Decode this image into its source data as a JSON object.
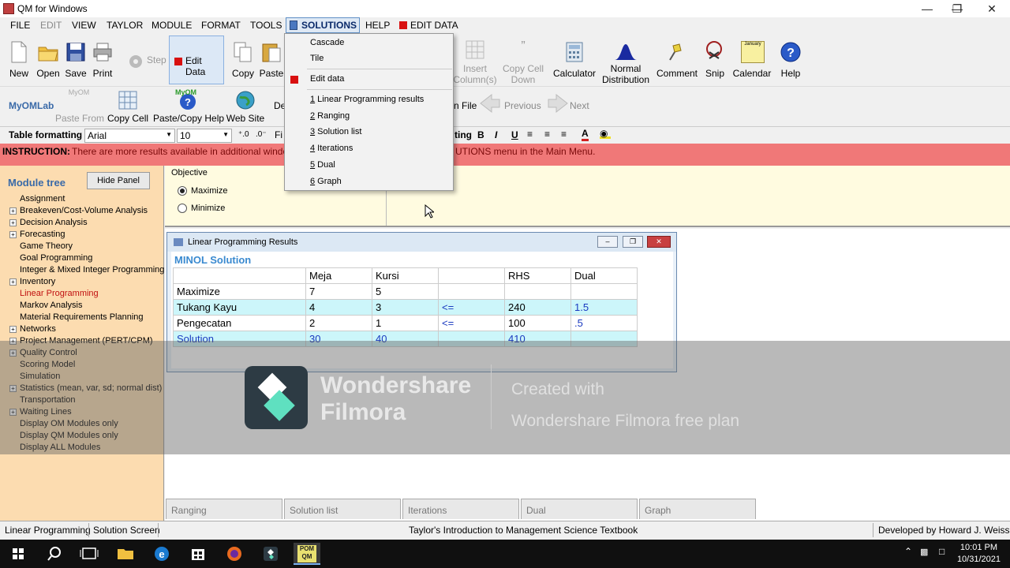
{
  "window": {
    "title": "QM for Windows"
  },
  "menu": {
    "file": "FILE",
    "edit": "EDIT",
    "view": "VIEW",
    "taylor": "TAYLOR",
    "module": "MODULE",
    "format": "FORMAT",
    "tools": "TOOLS",
    "solutions": "SOLUTIONS",
    "help": "HELP",
    "edit_data": "EDIT DATA"
  },
  "toolbar": {
    "new": "New",
    "open": "Open",
    "save": "Save",
    "print": "Print",
    "step": "Step",
    "edit_data": "Edit Data",
    "copy": "Copy",
    "paste": "Paste",
    "insert_columns_1": "Insert",
    "insert_columns_2": "Column(s)",
    "copy_cell_down_1": "Copy Cell",
    "copy_cell_down_2": "Down",
    "calculator": "Calculator",
    "normal_dist_1": "Normal",
    "normal_dist_2": "Distribution",
    "comment": "Comment",
    "snip": "Snip",
    "calendar": "Calendar",
    "help": "Help",
    "calendar_icon_text": "January"
  },
  "toolbar2": {
    "myomlab": "MyOMLab",
    "paste_from": "Paste From",
    "copy_cell": "Copy Cell",
    "paste_copy_help": "Paste/Copy Help",
    "web_site": "Web Site",
    "de_partial": "De",
    "file_partial": "n File",
    "previous": "Previous",
    "next": "Next",
    "myom_badge": "MyOM"
  },
  "formatbar": {
    "label": "Table formatting",
    "font": "Arial",
    "size": "10",
    "fi_partial": "Fi",
    "ting_partial": "ting"
  },
  "instruction": {
    "label": "INSTRUCTION:",
    "text_left": "There are more results available in additional windo",
    "text_right": "UTIONS menu in the Main Menu."
  },
  "module_tree": {
    "header": "Module tree",
    "hide_panel": "Hide Panel",
    "items": [
      {
        "label": "Assignment",
        "expandable": false
      },
      {
        "label": "Breakeven/Cost-Volume Analysis",
        "expandable": true
      },
      {
        "label": "Decision Analysis",
        "expandable": true
      },
      {
        "label": "Forecasting",
        "expandable": true
      },
      {
        "label": "Game Theory",
        "expandable": false
      },
      {
        "label": "Goal Programming",
        "expandable": false
      },
      {
        "label": "Integer & Mixed Integer Programming",
        "expandable": false
      },
      {
        "label": "Inventory",
        "expandable": true
      },
      {
        "label": "Linear Programming",
        "expandable": false,
        "selected": true
      },
      {
        "label": "Markov Analysis",
        "expandable": false
      },
      {
        "label": "Material Requirements Planning",
        "expandable": false
      },
      {
        "label": "Networks",
        "expandable": true
      },
      {
        "label": "Project Management (PERT/CPM)",
        "expandable": true
      },
      {
        "label": "Quality Control",
        "expandable": true
      },
      {
        "label": "Scoring Model",
        "expandable": false
      },
      {
        "label": "Simulation",
        "expandable": false
      },
      {
        "label": "Statistics (mean, var, sd; normal dist)",
        "expandable": true
      },
      {
        "label": "Transportation",
        "expandable": false
      },
      {
        "label": "Waiting Lines",
        "expandable": true
      },
      {
        "label": "Display OM Modules only",
        "expandable": false
      },
      {
        "label": "Display QM Modules only",
        "expandable": false
      },
      {
        "label": "Display ALL Modules",
        "expandable": false
      }
    ]
  },
  "objective": {
    "legend": "Objective",
    "maximize": "Maximize",
    "minimize": "Minimize",
    "selected": "Maximize"
  },
  "solutions_menu": {
    "cascade": "Cascade",
    "tile": "Tile",
    "edit_data": "Edit data",
    "items": [
      {
        "num": "1",
        "label": " Linear Programming results"
      },
      {
        "num": "2",
        "label": " Ranging"
      },
      {
        "num": "3",
        "label": " Solution list"
      },
      {
        "num": "4",
        "label": " Iterations"
      },
      {
        "num": "5",
        "label": " Dual"
      },
      {
        "num": "6",
        "label": " Graph"
      }
    ]
  },
  "results_window": {
    "title": "Linear Programming Results",
    "solution_title": "MINOL Solution",
    "headers": [
      "",
      "Meja",
      "Kursi",
      "",
      "RHS",
      "Dual"
    ],
    "rows": [
      [
        "Maximize",
        "7",
        "5",
        "",
        "",
        ""
      ],
      [
        "Tukang Kayu",
        "4",
        "3",
        "<=",
        "240",
        "1.5"
      ],
      [
        "Pengecatan",
        "2",
        "1",
        "<=",
        "100",
        ".5"
      ],
      [
        "Solution",
        "30",
        "40",
        "",
        "410",
        ""
      ]
    ]
  },
  "watermark": {
    "brand_1": "Wondershare",
    "brand_2": "Filmora",
    "line_1": "Created with",
    "line_2": "Wondershare Filmora free plan"
  },
  "bottom_tabs": [
    "Ranging",
    "Solution list",
    "Iterations",
    "Dual",
    "Graph"
  ],
  "statusbar": {
    "module": "Linear Programming",
    "screen": "Solution Screen",
    "textbook": "Taylor's Introduction to Management Science Textbook",
    "developer": "Developed by Howard J. Weiss"
  },
  "taskbar": {
    "time": "10:01 PM",
    "date": "10/31/2021",
    "pom_label": "POM QM"
  },
  "colors": {
    "instruction_bg": "#f07878",
    "panel_bg": "#fcdcb0",
    "result_cyan": "#ccf6fa",
    "accent_blue": "#3a8ad0"
  }
}
